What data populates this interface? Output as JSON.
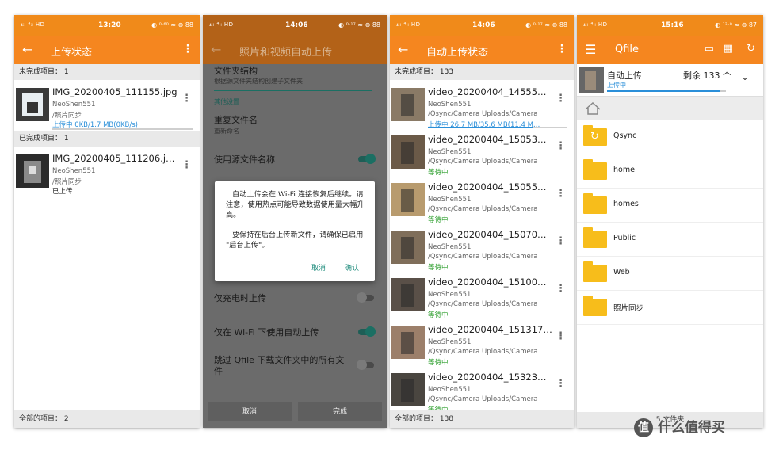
{
  "panel1": {
    "status": {
      "left": "₄ᵢₗ ⁴ᵢₗ HD",
      "time": "13:20",
      "right": "◐ ⁰·⁶⁰ ≈ ⊛ 88"
    },
    "title": "上传状态",
    "section_incomplete": "未完成项目： 1",
    "item1": {
      "name": "IMG_20200405_111155.jpg",
      "user": "NeoShen551",
      "path": "/照片同步",
      "status": "上传中  0KB/1.7 MB(0KB/s)",
      "progress": 0
    },
    "section_complete": "已完成项目： 1",
    "item2": {
      "name": "IMG_20200405_111206.j…",
      "user": "NeoShen551",
      "path": "/照片同步",
      "status": "已上传"
    },
    "footer": "全部的项目： 2"
  },
  "panel2": {
    "status": {
      "left": "₄ᵢₗ ⁴ᵢₗ HD",
      "time": "14:06",
      "right": "◐ ⁰·¹⁷ ≈ ⊛ 88"
    },
    "title": "照片和视频自动上传",
    "folder_struct": "文件夹结构",
    "folder_struct_sub": "根据源文件夹结构创建子文件夹",
    "other_settings": "其他设置",
    "dup_name": "重复文件名",
    "dup_name_sub": "重新命名",
    "use_source_name": "使用源文件名称",
    "dialog_msg1": "自动上传会在 Wi-Fi 连接恢复后继续。请注意，使用热点可能导致数据使用量大幅升高。",
    "dialog_msg2": "要保持在后台上传新文件，请确保已启用 \"后台上传\"。",
    "dialog_cancel": "取消",
    "dialog_ok": "确认",
    "charge_only": "仅充电时上传",
    "wifi_only": "仅在 Wi-Fi 下使用自动上传",
    "skip_qfile": "跳过 Qfile 下载文件夹中的所有文件",
    "btn_cancel": "取消",
    "btn_done": "完成"
  },
  "panel3": {
    "status": {
      "left": "₄ᵢₗ ⁴ᵢₗ HD",
      "time": "14:06",
      "right": "◐ ⁰·¹⁷ ≈ ⊛ 88"
    },
    "title": "自动上传状态",
    "section_incomplete": "未完成项目： 133",
    "items": [
      {
        "name": "video_20200404_14555…",
        "user": "NeoShen551",
        "path": "/Qsync/Camera Uploads/Camera",
        "status": "上传中  26.7 MB/35.6 MB(11.4 M…",
        "kind": "uploading",
        "progress": 0.75
      },
      {
        "name": "video_20200404_15053…",
        "user": "NeoShen551",
        "path": "/Qsync/Camera Uploads/Camera",
        "status": "等待中",
        "kind": "waiting"
      },
      {
        "name": "video_20200404_15055…",
        "user": "NeoShen551",
        "path": "/Qsync/Camera Uploads/Camera",
        "status": "等待中",
        "kind": "waiting"
      },
      {
        "name": "video_20200404_15070…",
        "user": "NeoShen551",
        "path": "/Qsync/Camera Uploads/Camera",
        "status": "等待中",
        "kind": "waiting"
      },
      {
        "name": "video_20200404_15100…",
        "user": "NeoShen551",
        "path": "/Qsync/Camera Uploads/Camera",
        "status": "等待中",
        "kind": "waiting"
      },
      {
        "name": "video_20200404_151317…",
        "user": "NeoShen551",
        "path": "/Qsync/Camera Uploads/Camera",
        "status": "等待中",
        "kind": "waiting"
      },
      {
        "name": "video_20200404_15323…",
        "user": "NeoShen551",
        "path": "/Qsync/Camera Uploads/Camera",
        "status": "等待中",
        "kind": "waiting"
      }
    ],
    "footer": "全部的项目： 138"
  },
  "panel4": {
    "status": {
      "left": "₄ᵢₗ ⁴ᵢₗ HD",
      "time": "15:16",
      "right": "◐ ¹²·⁰ ≈ ⊛ 87"
    },
    "title": "Qfile",
    "upload_name": "自动上传",
    "upload_remaining": "剩余 133 个",
    "upload_status": "上传中",
    "upload_progress": 0.95,
    "folders": [
      "Qsync",
      "home",
      "homes",
      "Public",
      "Web",
      "照片同步"
    ],
    "footer": "5 文件夹"
  },
  "watermark": "什么值得买",
  "colors": {
    "orange": "#f5861f",
    "blue": "#2a8fd9",
    "green": "#2e9f2e",
    "folder": "#f7bd1b"
  }
}
